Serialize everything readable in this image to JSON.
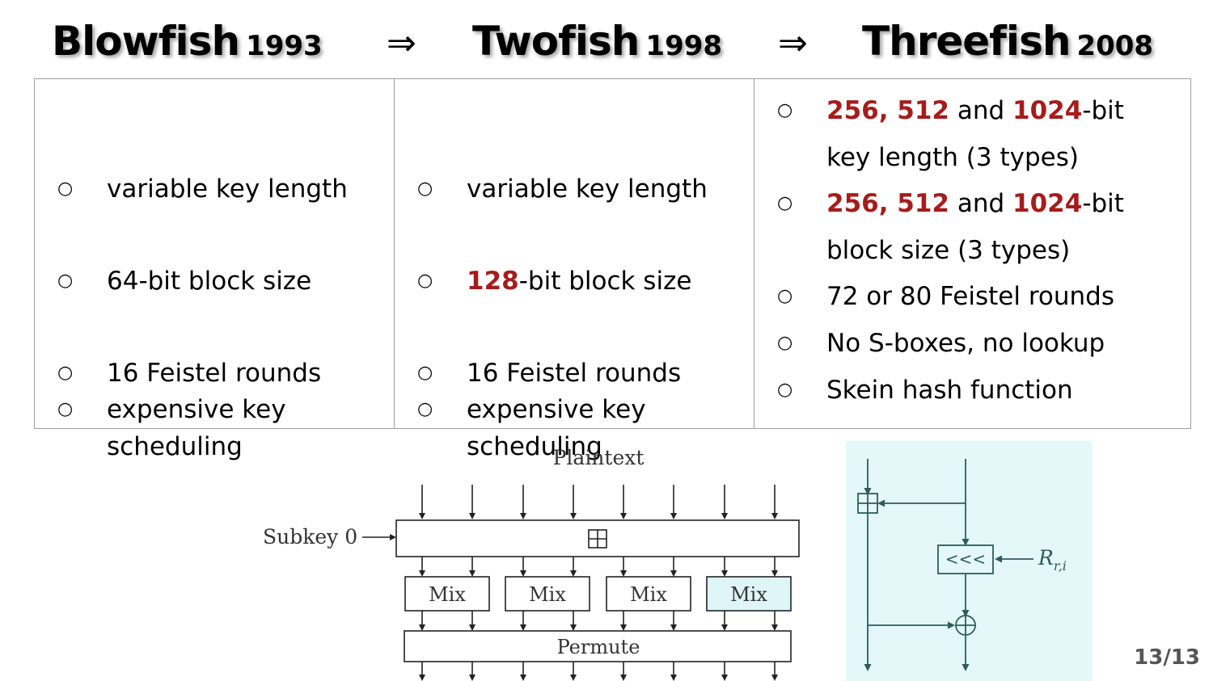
{
  "title": {
    "items": [
      {
        "name": "Blowfish",
        "year": "1993"
      },
      {
        "name": "Twofish",
        "year": "1998"
      },
      {
        "name": "Threefish",
        "year": "2008"
      }
    ],
    "arrow": "⇒"
  },
  "bullet_mark": "○",
  "columns": [
    {
      "items": [
        {
          "plain": "variable key length"
        },
        {
          "plain": "64-bit block size"
        },
        {
          "plain": "16 Feistel rounds"
        },
        {
          "line1": "expensive key",
          "line2": "scheduling"
        }
      ]
    },
    {
      "items": [
        {
          "plain": "variable key length"
        },
        {
          "red": "128",
          "rest": "-bit block size"
        },
        {
          "plain": "16 Feistel rounds"
        },
        {
          "line1": "expensive key",
          "line2": "scheduling"
        }
      ]
    },
    {
      "items": [
        {
          "red1": "256, 512",
          "mid": " and ",
          "red2": "1024",
          "rest": "-bit",
          "line2": "key length (3 types)"
        },
        {
          "red1": "256, 512",
          "mid": " and ",
          "red2": "1024",
          "rest": "-bit",
          "line2": "block size (3 types)"
        },
        {
          "plain": "72 or 80 Feistel rounds"
        },
        {
          "plain": "No S-boxes, no lookup"
        },
        {
          "plain": "Skein hash function"
        }
      ]
    }
  ],
  "diagram_left": {
    "plaintext_label": "Plaintext",
    "subkey_label": "Subkey 0",
    "add_symbol": "⊞",
    "mix_label": "Mix",
    "permute_label": "Permute",
    "highlight_color": "#dff6f8"
  },
  "diagram_right": {
    "rotate_symbol": "<<<",
    "r_label": "R",
    "r_subscript": "r,i",
    "background": "#e4f8fa"
  },
  "page_number": "13/13",
  "colors": {
    "accent_red": "#a61c1c",
    "border": "#9e9e9e"
  }
}
